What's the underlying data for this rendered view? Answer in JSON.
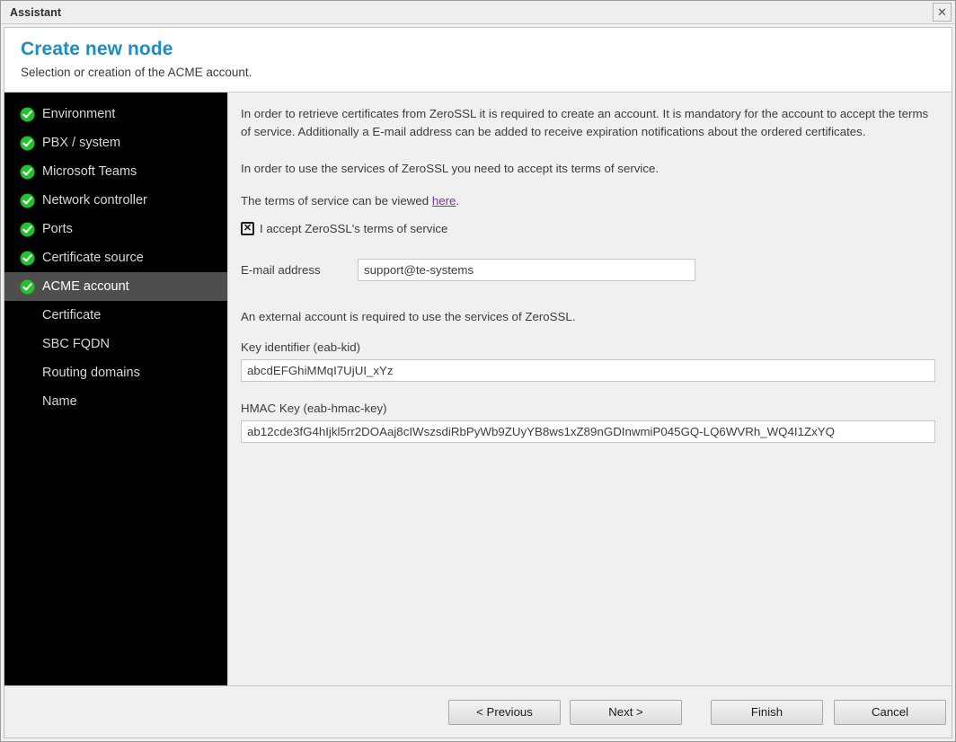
{
  "window": {
    "title": "Assistant",
    "close_icon": "close-icon",
    "close_glyph": "✕"
  },
  "header": {
    "title": "Create new node",
    "subtitle": "Selection or creation of the ACME account.",
    "title_color": "#1e8bc3"
  },
  "sidebar": {
    "background": "#000000",
    "active_background": "#4e4e4e",
    "check_color": "#22c32a",
    "items": [
      {
        "label": "Environment",
        "completed": true,
        "active": false
      },
      {
        "label": "PBX / system",
        "completed": true,
        "active": false
      },
      {
        "label": "Microsoft Teams",
        "completed": true,
        "active": false
      },
      {
        "label": "Network controller",
        "completed": true,
        "active": false
      },
      {
        "label": "Ports",
        "completed": true,
        "active": false
      },
      {
        "label": "Certificate source",
        "completed": true,
        "active": false
      },
      {
        "label": "ACME account",
        "completed": true,
        "active": true
      },
      {
        "label": "Certificate",
        "completed": false,
        "active": false
      },
      {
        "label": "SBC FQDN",
        "completed": false,
        "active": false
      },
      {
        "label": "Routing domains",
        "completed": false,
        "active": false
      },
      {
        "label": "Name",
        "completed": false,
        "active": false
      }
    ]
  },
  "main": {
    "intro_paragraph": "In order to retrieve certificates from ZeroSSL it is required to create an account. It is mandatory for the account to accept the terms of service. Additionally a E-mail address can be added to receive expiration notifications about the ordered certificates.",
    "accept_paragraph": "In order to use the services of ZeroSSL you need to accept its terms of service.",
    "tos_prefix": "The terms of service can be viewed ",
    "tos_link_text": "here",
    "tos_suffix": ".",
    "tos_link_color": "#7b2fa8",
    "accept_checkbox": {
      "label": "I accept ZeroSSL's terms of service",
      "checked": true,
      "glyph": "✕"
    },
    "email_field": {
      "label": "E-mail address",
      "value": "support@te-systems",
      "placeholder": ""
    },
    "external_account_paragraph": "An external account is required to use the services of ZeroSSL.",
    "key_identifier_field": {
      "label": "Key identifier (eab-kid)",
      "value": "abcdEFGhiMMqI7UjUI_xYz",
      "placeholder": ""
    },
    "hmac_key_field": {
      "label": "HMAC Key (eab-hmac-key)",
      "value": "ab12cde3fG4hIjkl5rr2DOAaj8cIWszsdiRbPyWb9ZUyYB8ws1xZ89nGDInwmiP045GQ-LQ6WVRh_WQ4I1ZxYQ",
      "placeholder": ""
    }
  },
  "footer": {
    "previous_label": "< Previous",
    "next_label": "Next >",
    "finish_label": "Finish",
    "cancel_label": "Cancel"
  }
}
